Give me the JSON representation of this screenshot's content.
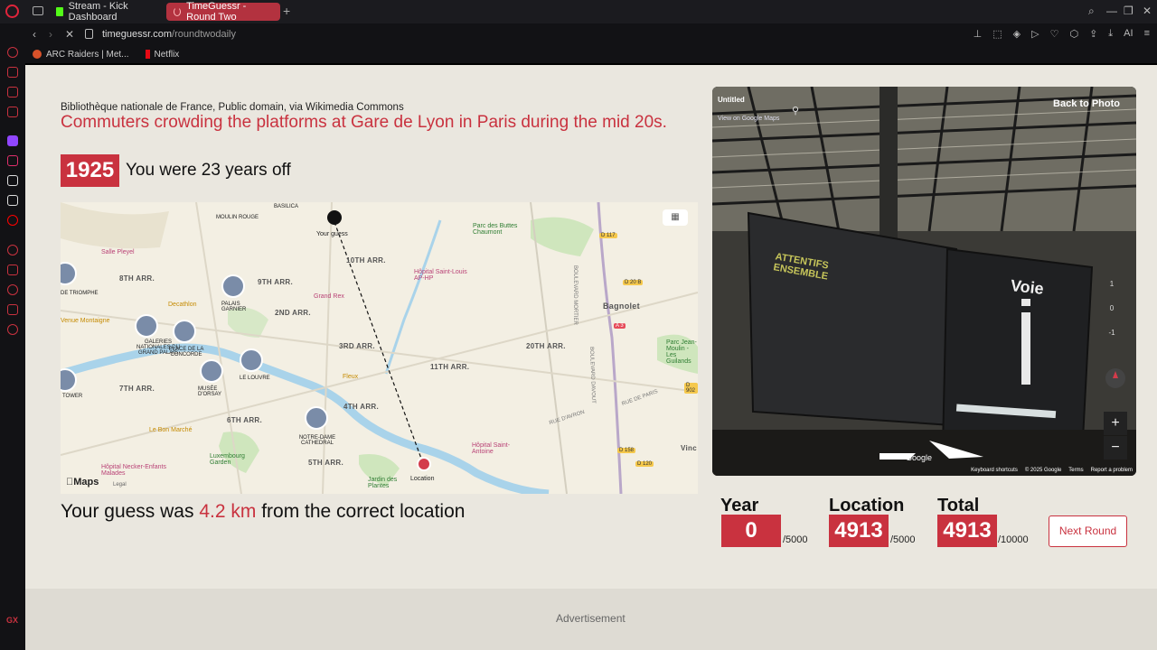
{
  "browser": {
    "tabs": [
      {
        "label": "Stream - Kick Dashboard"
      },
      {
        "label": "TimeGuessr - Round Two"
      }
    ],
    "url_host": "timeguessr.com",
    "url_path": "/roundtwodaily",
    "bookmarks": [
      {
        "label": "ARC Raiders | Met..."
      },
      {
        "label": "Netflix"
      }
    ],
    "toolbar_ai": "AI"
  },
  "result": {
    "credit": "Bibliothèque nationale de France, Public domain, via Wikimedia Commons",
    "headline": "Commuters crowding the platforms at Gare de Lyon in Paris during the mid 20s.",
    "year": "1925",
    "years_off": "You were 23 years off",
    "guess_prefix": "Your guess was ",
    "guess_km": "4.2 km",
    "guess_suffix": " from the correct location"
  },
  "map": {
    "districts": [
      "8TH ARR.",
      "9TH ARR.",
      "10TH ARR.",
      "2ND ARR.",
      "3RD ARR.",
      "11TH ARR.",
      "20TH ARR.",
      "7TH ARR.",
      "4TH ARR.",
      "6TH ARR.",
      "5TH ARR."
    ],
    "pois": [
      "Salle Pleyel",
      "Decathlon",
      "Grand Rex",
      "Hôpital Saint-Louis AP-HP",
      "Parc des Buttes Chaumont",
      "Bagnolet",
      "Parc Jean-Moulin - Les Guilands",
      "Fleux",
      "Le Bon Marché",
      "Luxembourg Garden",
      "Hôpital Saint-Antoine",
      "Jardin des Plantes",
      "Hôpital Necker-Enfants Malades",
      "Venue Montaigne",
      "MOULIN ROUGE",
      "BASILICA",
      "PALAIS GARNIER",
      "GALERIES NATIONALES DU GRAND PALAIS",
      "PLACE DE LA CONCORDE",
      "MUSÉE D'ORSAY",
      "LE LOUVRE",
      "NOTRE-DAME CATHEDRAL",
      "TOWER",
      "DE TRIOMPHE",
      "BOULEVARD MORTIER",
      "BOULEVARD DAVOUT",
      "RUE DE PARIS",
      "RUE D'AVRON",
      "Vinc"
    ],
    "road_tags": [
      "D 117",
      "D 20 B",
      "A 3",
      "D 902",
      "D 158",
      "D 120"
    ],
    "your_guess_label": "Your guess",
    "location_label": "Location",
    "maps_logo": "Maps",
    "legal": "Legal"
  },
  "photo": {
    "untitled": "Untitled",
    "view_on_google": "View on Google Maps",
    "back_to_photo": "Back to Photo",
    "levels": [
      "1",
      "0",
      "-1"
    ],
    "google": "Google",
    "footer": [
      "Keyboard shortcuts",
      "© 2025 Google",
      "Terms",
      "Report a problem"
    ],
    "signs": {
      "attentifs": "ATTENTIFS ENSEMBLE",
      "voie": "Voie",
      "i": "i"
    }
  },
  "score": {
    "year_label": "Year",
    "year_value": "0",
    "year_max": "/5000",
    "location_label": "Location",
    "location_value": "4913",
    "location_max": "/5000",
    "total_label": "Total",
    "total_value": "4913",
    "total_max": "/10000",
    "next_button": "Next Round"
  },
  "ad_label": "Advertisement",
  "colors": {
    "accent": "#c9323f",
    "page_bg": "#eae7df"
  }
}
